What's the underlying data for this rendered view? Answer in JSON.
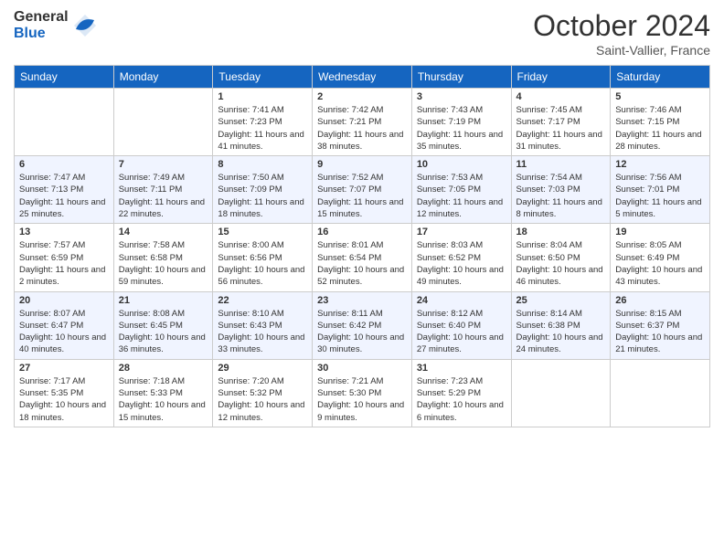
{
  "header": {
    "logo_general": "General",
    "logo_blue": "Blue",
    "month_title": "October 2024",
    "location": "Saint-Vallier, France"
  },
  "days_of_week": [
    "Sunday",
    "Monday",
    "Tuesday",
    "Wednesday",
    "Thursday",
    "Friday",
    "Saturday"
  ],
  "weeks": [
    [
      {
        "day": "",
        "info": ""
      },
      {
        "day": "",
        "info": ""
      },
      {
        "day": "1",
        "info": "Sunrise: 7:41 AM\nSunset: 7:23 PM\nDaylight: 11 hours and 41 minutes."
      },
      {
        "day": "2",
        "info": "Sunrise: 7:42 AM\nSunset: 7:21 PM\nDaylight: 11 hours and 38 minutes."
      },
      {
        "day": "3",
        "info": "Sunrise: 7:43 AM\nSunset: 7:19 PM\nDaylight: 11 hours and 35 minutes."
      },
      {
        "day": "4",
        "info": "Sunrise: 7:45 AM\nSunset: 7:17 PM\nDaylight: 11 hours and 31 minutes."
      },
      {
        "day": "5",
        "info": "Sunrise: 7:46 AM\nSunset: 7:15 PM\nDaylight: 11 hours and 28 minutes."
      }
    ],
    [
      {
        "day": "6",
        "info": "Sunrise: 7:47 AM\nSunset: 7:13 PM\nDaylight: 11 hours and 25 minutes."
      },
      {
        "day": "7",
        "info": "Sunrise: 7:49 AM\nSunset: 7:11 PM\nDaylight: 11 hours and 22 minutes."
      },
      {
        "day": "8",
        "info": "Sunrise: 7:50 AM\nSunset: 7:09 PM\nDaylight: 11 hours and 18 minutes."
      },
      {
        "day": "9",
        "info": "Sunrise: 7:52 AM\nSunset: 7:07 PM\nDaylight: 11 hours and 15 minutes."
      },
      {
        "day": "10",
        "info": "Sunrise: 7:53 AM\nSunset: 7:05 PM\nDaylight: 11 hours and 12 minutes."
      },
      {
        "day": "11",
        "info": "Sunrise: 7:54 AM\nSunset: 7:03 PM\nDaylight: 11 hours and 8 minutes."
      },
      {
        "day": "12",
        "info": "Sunrise: 7:56 AM\nSunset: 7:01 PM\nDaylight: 11 hours and 5 minutes."
      }
    ],
    [
      {
        "day": "13",
        "info": "Sunrise: 7:57 AM\nSunset: 6:59 PM\nDaylight: 11 hours and 2 minutes."
      },
      {
        "day": "14",
        "info": "Sunrise: 7:58 AM\nSunset: 6:58 PM\nDaylight: 10 hours and 59 minutes."
      },
      {
        "day": "15",
        "info": "Sunrise: 8:00 AM\nSunset: 6:56 PM\nDaylight: 10 hours and 56 minutes."
      },
      {
        "day": "16",
        "info": "Sunrise: 8:01 AM\nSunset: 6:54 PM\nDaylight: 10 hours and 52 minutes."
      },
      {
        "day": "17",
        "info": "Sunrise: 8:03 AM\nSunset: 6:52 PM\nDaylight: 10 hours and 49 minutes."
      },
      {
        "day": "18",
        "info": "Sunrise: 8:04 AM\nSunset: 6:50 PM\nDaylight: 10 hours and 46 minutes."
      },
      {
        "day": "19",
        "info": "Sunrise: 8:05 AM\nSunset: 6:49 PM\nDaylight: 10 hours and 43 minutes."
      }
    ],
    [
      {
        "day": "20",
        "info": "Sunrise: 8:07 AM\nSunset: 6:47 PM\nDaylight: 10 hours and 40 minutes."
      },
      {
        "day": "21",
        "info": "Sunrise: 8:08 AM\nSunset: 6:45 PM\nDaylight: 10 hours and 36 minutes."
      },
      {
        "day": "22",
        "info": "Sunrise: 8:10 AM\nSunset: 6:43 PM\nDaylight: 10 hours and 33 minutes."
      },
      {
        "day": "23",
        "info": "Sunrise: 8:11 AM\nSunset: 6:42 PM\nDaylight: 10 hours and 30 minutes."
      },
      {
        "day": "24",
        "info": "Sunrise: 8:12 AM\nSunset: 6:40 PM\nDaylight: 10 hours and 27 minutes."
      },
      {
        "day": "25",
        "info": "Sunrise: 8:14 AM\nSunset: 6:38 PM\nDaylight: 10 hours and 24 minutes."
      },
      {
        "day": "26",
        "info": "Sunrise: 8:15 AM\nSunset: 6:37 PM\nDaylight: 10 hours and 21 minutes."
      }
    ],
    [
      {
        "day": "27",
        "info": "Sunrise: 7:17 AM\nSunset: 5:35 PM\nDaylight: 10 hours and 18 minutes."
      },
      {
        "day": "28",
        "info": "Sunrise: 7:18 AM\nSunset: 5:33 PM\nDaylight: 10 hours and 15 minutes."
      },
      {
        "day": "29",
        "info": "Sunrise: 7:20 AM\nSunset: 5:32 PM\nDaylight: 10 hours and 12 minutes."
      },
      {
        "day": "30",
        "info": "Sunrise: 7:21 AM\nSunset: 5:30 PM\nDaylight: 10 hours and 9 minutes."
      },
      {
        "day": "31",
        "info": "Sunrise: 7:23 AM\nSunset: 5:29 PM\nDaylight: 10 hours and 6 minutes."
      },
      {
        "day": "",
        "info": ""
      },
      {
        "day": "",
        "info": ""
      }
    ]
  ]
}
